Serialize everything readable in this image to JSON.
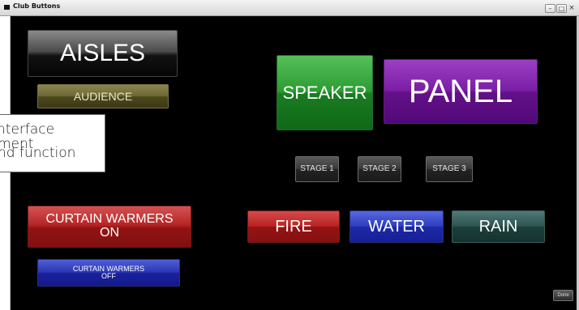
{
  "window": {
    "title": "Club Buttons",
    "controls": [
      "–",
      "□",
      "×"
    ]
  },
  "buttons": {
    "aisles": "AISLES",
    "audience": "AUDIENCE",
    "speaker": "SPEAKER",
    "panel": "PANEL",
    "stage1": "STAGE 1",
    "stage2": "STAGE 2",
    "stage3": "STAGE 3",
    "curtain_warmers_on_line1": "CURTAIN WARMERS",
    "curtain_warmers_on_line2": "ON",
    "curtain_warmers_off_line1": "CURTAIN WARMERS",
    "curtain_warmers_off_line2": "OFF",
    "fire": "FIRE",
    "water": "WATER",
    "rain": "RAIN",
    "done": "Done"
  },
  "callout": {
    "line1": "nterface",
    "line2": "ment",
    "line3": "nd function"
  },
  "colors": {
    "background": "#000000",
    "speaker": "#2c9c33",
    "panel": "#7a1fa6",
    "fire": "#b82323",
    "water": "#2d3ec0",
    "rain": "#2d5450",
    "audience": "#6e6935"
  }
}
